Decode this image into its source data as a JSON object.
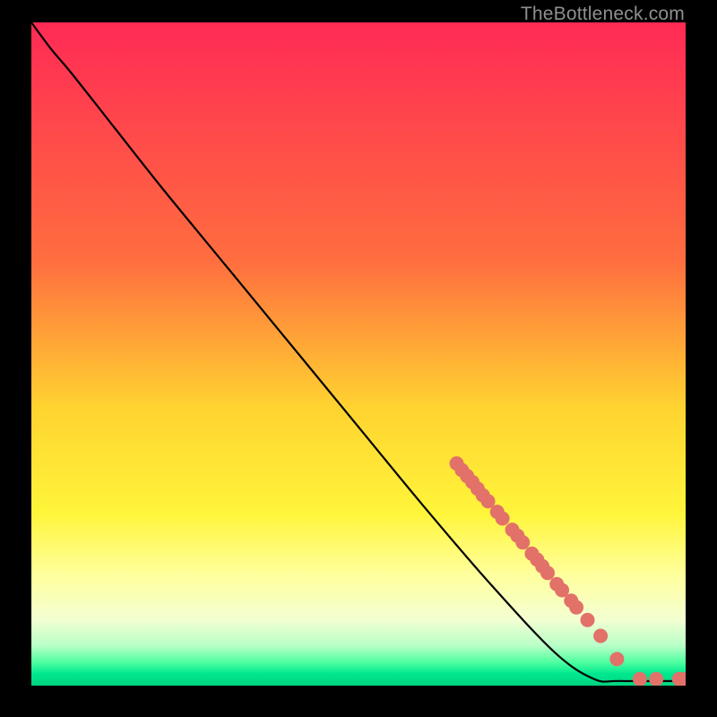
{
  "watermark": "TheBottleneck.com",
  "chart_data": {
    "type": "line",
    "title": "",
    "xlabel": "",
    "ylabel": "",
    "xlim": [
      0,
      100
    ],
    "ylim": [
      0,
      100
    ],
    "gradient_stops": [
      {
        "pos": 0,
        "color": "#ff2a55"
      },
      {
        "pos": 36,
        "color": "#ff6e3f"
      },
      {
        "pos": 58,
        "color": "#ffd330"
      },
      {
        "pos": 74,
        "color": "#fff53a"
      },
      {
        "pos": 83,
        "color": "#ffff9a"
      },
      {
        "pos": 90,
        "color": "#f4ffd2"
      },
      {
        "pos": 94,
        "color": "#b7ffc7"
      },
      {
        "pos": 96.5,
        "color": "#4effa0"
      },
      {
        "pos": 98.2,
        "color": "#00e890"
      },
      {
        "pos": 100,
        "color": "#00d380"
      }
    ],
    "series": [
      {
        "name": "curve",
        "points": [
          {
            "x": 0.0,
            "y": 100.0
          },
          {
            "x": 3.0,
            "y": 96.0
          },
          {
            "x": 6.0,
            "y": 92.5
          },
          {
            "x": 12.0,
            "y": 85.0
          },
          {
            "x": 20.0,
            "y": 75.0
          },
          {
            "x": 30.0,
            "y": 63.0
          },
          {
            "x": 40.0,
            "y": 51.0
          },
          {
            "x": 50.0,
            "y": 39.0
          },
          {
            "x": 60.0,
            "y": 27.0
          },
          {
            "x": 70.0,
            "y": 15.5
          },
          {
            "x": 80.0,
            "y": 5.0
          },
          {
            "x": 86.0,
            "y": 1.0
          },
          {
            "x": 90.0,
            "y": 0.7
          },
          {
            "x": 100.0,
            "y": 0.7
          }
        ]
      }
    ],
    "markers": [
      {
        "x": 65.0,
        "y": 33.5
      },
      {
        "x": 65.8,
        "y": 32.5
      },
      {
        "x": 66.6,
        "y": 31.6
      },
      {
        "x": 67.4,
        "y": 30.7
      },
      {
        "x": 68.2,
        "y": 29.7
      },
      {
        "x": 69.0,
        "y": 28.7
      },
      {
        "x": 69.8,
        "y": 27.8
      },
      {
        "x": 71.2,
        "y": 26.2
      },
      {
        "x": 72.0,
        "y": 25.2
      },
      {
        "x": 73.5,
        "y": 23.5
      },
      {
        "x": 74.3,
        "y": 22.6
      },
      {
        "x": 75.1,
        "y": 21.6
      },
      {
        "x": 76.5,
        "y": 19.9
      },
      {
        "x": 77.3,
        "y": 19.0
      },
      {
        "x": 78.1,
        "y": 18.0
      },
      {
        "x": 78.9,
        "y": 17.0
      },
      {
        "x": 80.3,
        "y": 15.3
      },
      {
        "x": 81.1,
        "y": 14.4
      },
      {
        "x": 82.5,
        "y": 12.8
      },
      {
        "x": 83.3,
        "y": 11.8
      },
      {
        "x": 85.0,
        "y": 9.9
      },
      {
        "x": 87.0,
        "y": 7.5
      },
      {
        "x": 89.5,
        "y": 4.0
      },
      {
        "x": 93.0,
        "y": 1.0
      },
      {
        "x": 95.5,
        "y": 1.0
      },
      {
        "x": 99.0,
        "y": 1.0
      },
      {
        "x": 100.0,
        "y": 1.0
      }
    ],
    "marker_style": {
      "color": "#e27169",
      "radius": 8
    }
  }
}
